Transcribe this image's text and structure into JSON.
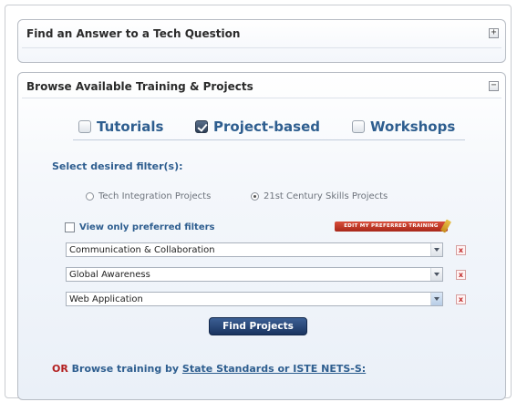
{
  "panels": {
    "tech_question": {
      "title": "Find an Answer to a Tech Question",
      "toggle": "+"
    },
    "browse_training": {
      "title": "Browse Available Training & Projects",
      "toggle": "−"
    }
  },
  "tabs": [
    {
      "label": "Tutorials",
      "checked": false
    },
    {
      "label": "Project-based",
      "checked": true
    },
    {
      "label": "Workshops",
      "checked": false
    }
  ],
  "filters": {
    "heading": "Select desired filter(s):",
    "radios": [
      {
        "label": "Tech Integration Projects",
        "selected": false
      },
      {
        "label": "21st Century Skills Projects",
        "selected": true
      }
    ],
    "preferred_label": "View only preferred filters",
    "preferred_checked": false,
    "edit_preferred_label": "EDIT MY PREFERRED TRAINING",
    "selects": [
      {
        "value": "Communication & Collaboration"
      },
      {
        "value": "Global Awareness"
      },
      {
        "value": "Web Application"
      }
    ],
    "remove_label": "x"
  },
  "find_button": "Find Projects",
  "browse": {
    "or": "OR",
    "text": " Browse training by ",
    "link": "State Standards or ISTE NETS-S:"
  }
}
